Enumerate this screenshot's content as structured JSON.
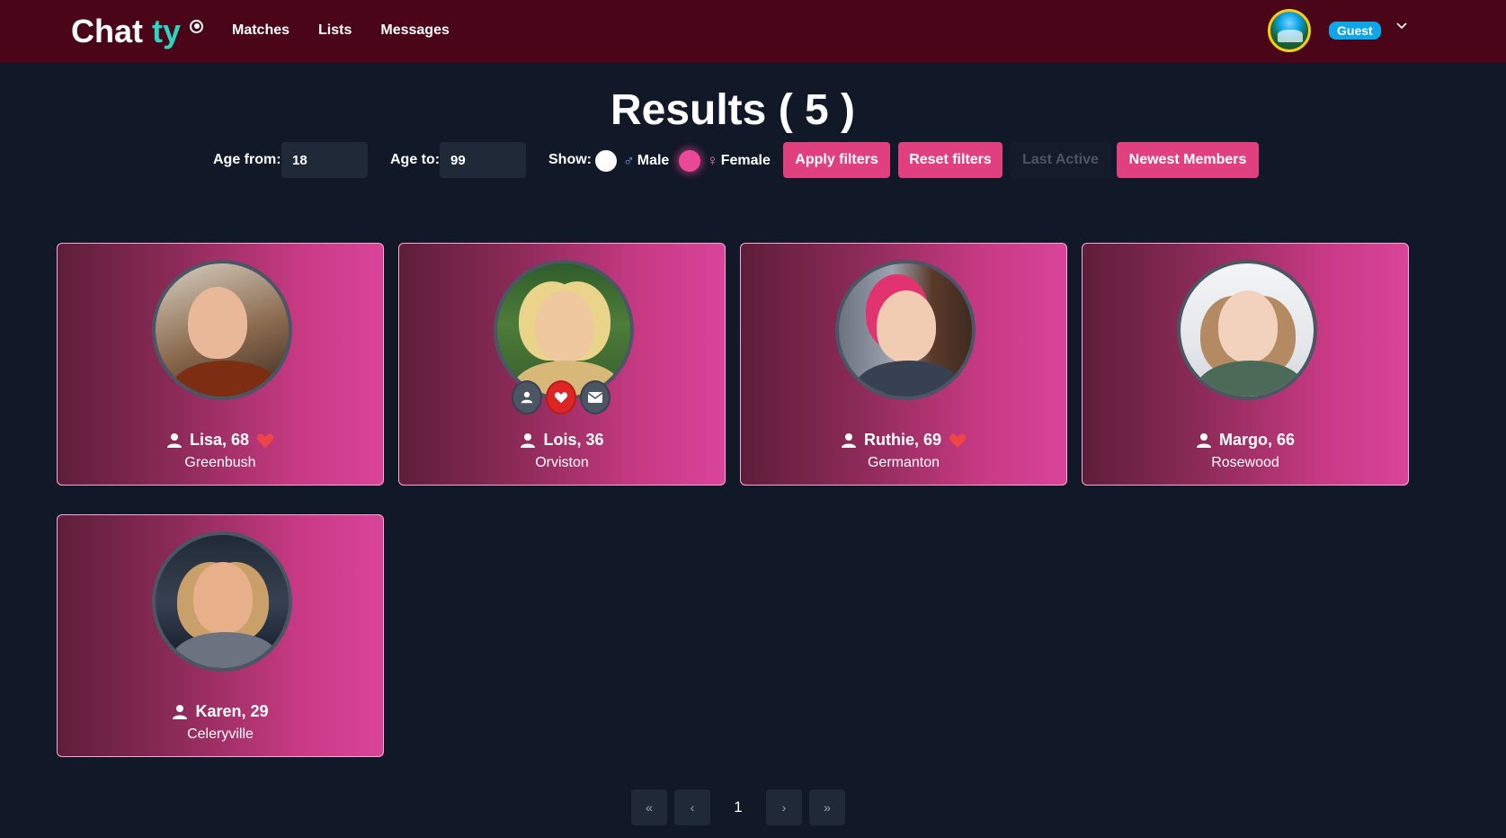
{
  "nav": {
    "brand_part1": "Chat",
    "brand_part2": "ty",
    "links": [
      "Matches",
      "Lists",
      "Messages"
    ],
    "user_badge": "Guest",
    "dropdown_icon": "chevron-down-icon"
  },
  "header": {
    "title": "Results ( 5 )"
  },
  "filters": {
    "age_from_label": "Age from:",
    "age_from_value": "18",
    "age_to_label": "Age to:",
    "age_to_value": "99",
    "show_label": "Show:",
    "male_label": "Male",
    "female_label": "Female",
    "male_selected": false,
    "female_selected": true,
    "apply_label": "Apply filters",
    "reset_label": "Reset filters",
    "last_active_label": "Last Active",
    "newest_label": "Newest Members"
  },
  "members": [
    {
      "name": "Lisa, 68",
      "city": "Greenbush",
      "liked": true
    },
    {
      "name": "Lois, 36",
      "city": "Orviston",
      "liked": false
    },
    {
      "name": "Ruthie, 69",
      "city": "Germanton",
      "liked": true
    },
    {
      "name": "Margo, 66",
      "city": "Rosewood",
      "liked": false
    },
    {
      "name": "Karen, 29",
      "city": "Celeryville",
      "liked": false
    }
  ],
  "pagination": {
    "first": "«",
    "prev": "‹",
    "current": "1",
    "next": "›",
    "last": "»"
  },
  "colors": {
    "navbar": "#4a0519",
    "background": "#111827",
    "accent_pink": "#e0407e",
    "brand_teal": "#2dd4bf",
    "heart_red": "#ef4444"
  }
}
